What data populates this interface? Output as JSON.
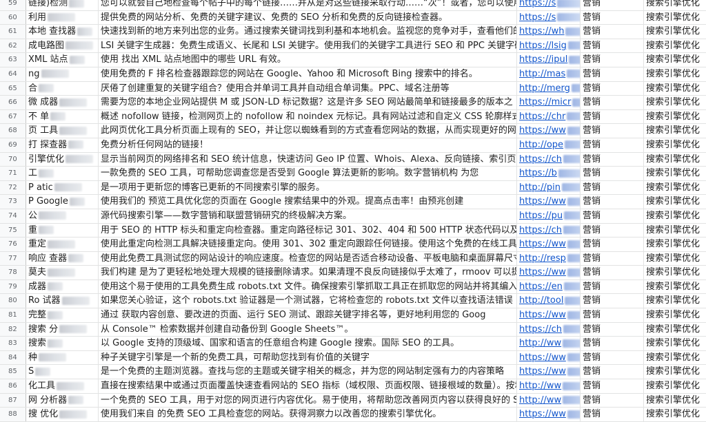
{
  "rows": [
    {
      "n": "59",
      "name": "链接)检测",
      "desc": "您可以就会自己地检查每个帖子中的每个链接……并从是对这些链接采取行动……“次”！或者，您可以使用",
      "url": "https://s",
      "cat": "营销",
      "sub": "搜索引擎优化"
    },
    {
      "n": "60",
      "name": "利用",
      "desc": "提供免费的网站分析、免费的关键字建议、免费的 SEO 分析和免费的反向链接检查器。",
      "url": "https://s",
      "cat": "营销",
      "sub": "搜索引擎优化"
    },
    {
      "n": "61",
      "name": "本地 查找器",
      "desc": "快速找到新的地方来列出您的业务。通过搜索关键词找到利基和本地机会。监视您的竞争对手，查看他们的引用并",
      "url": "https://wh",
      "cat": "营销",
      "sub": "搜索引擎优化"
    },
    {
      "n": "62",
      "name": "成电路图",
      "desc": "LSI 关键字生成器：免费生成语义、长尾和 LSI 关键字。使用我们的关键字工具进行 SEO 和 PPC 关键字研究、页",
      "url": "https://lsig",
      "cat": "营销",
      "sub": "搜索引擎优化"
    },
    {
      "n": "63",
      "name": "XML 站点",
      "desc": "使用 找出 XML 站点地图中的哪些 URL 有效。",
      "url": "https://ipul",
      "cat": "营销",
      "sub": "搜索引擎优化"
    },
    {
      "n": "64",
      "name": "ng",
      "desc": "使用免费的 F 排名检查器跟踪您的网站在 Google、Yahoo 和 Microsoft Bing 搜索中的排名。",
      "url": "http://mas",
      "cat": "营销",
      "sub": "搜索引擎优化"
    },
    {
      "n": "65",
      "name": "合",
      "desc": "厌倦了创建重复的关键字组合？使用合并单词工具并自动组合单词集。PPC、域名注册等",
      "url": "http://merg",
      "cat": "营销",
      "sub": "搜索引擎优化"
    },
    {
      "n": "66",
      "name": "微 成器",
      "desc": "需要为您的本地企业网站提供 M 或 JSON-LD 标记数据？这是许多 SEO 网站最简单和链接最多的版本之",
      "url": "https://micr",
      "cat": "营销",
      "sub": "搜索引擎优化"
    },
    {
      "n": "67",
      "name": "不 单",
      "desc": "概述 nofollow 链接，检测网页上的 nofollow 和 noindex 元标记。具有网站过滤和自定义 CSS 轮廓样式。",
      "url": "https://chr",
      "cat": "营销",
      "sub": "搜索引擎优化"
    },
    {
      "n": "68",
      "name": "页 工具",
      "desc": "此网页优化工具分析页面上现有的 SEO，并让您以蜘蛛看到的方式查看您网站的数据，从而实现更好的网页优化。",
      "url": "https://ww",
      "cat": "营销",
      "sub": "搜索引擎优化"
    },
    {
      "n": "69",
      "name": "打 探查器",
      "desc": "免费分析任何网站的链接！",
      "url": "http://ope",
      "cat": "营销",
      "sub": "搜索引擎优化"
    },
    {
      "n": "70",
      "name": "引擎优化",
      "desc": "显示当前网页的网络排名和 SEO 统计信息，快速访问 Geo IP 位置、Whois、Alexa、反向链接、索引页面等。",
      "url": "https://ch",
      "cat": "营销",
      "sub": "搜索引擎优化"
    },
    {
      "n": "71",
      "name": "工",
      "desc": "一款免费的 SEO 工具，可帮助您调查您是否受到 Google 算法更新的影响。数字营销机构 为您",
      "url": "https://b",
      "cat": "营销",
      "sub": "搜索引擎优化"
    },
    {
      "n": "72",
      "name": "P atic",
      "desc": "是一项用于更新您的博客已更新的不同搜索引擎的服务。",
      "url": "http://pin",
      "cat": "营销",
      "sub": "搜索引擎优化"
    },
    {
      "n": "73",
      "name": "P Google",
      "desc": "使用我们的 预览工具优化您的页面在 Google 搜索结果中的外观。提高点击率！由预兆创建",
      "url": "https://ww",
      "cat": "营销",
      "sub": "搜索引擎优化"
    },
    {
      "n": "74",
      "name": "公",
      "desc": "源代码搜索引擎——数字营销和联盟营销研究的终极解决方案。",
      "url": "https://pu",
      "cat": "营销",
      "sub": "搜索引擎优化"
    },
    {
      "n": "75",
      "name": "重",
      "desc": "用于 SEO 的 HTTP 标头和重定向检查器。重定向路径标记 301、302、404 和 500 HTTP 状态代码以及客户端重",
      "url": "https://ch",
      "cat": "营销",
      "sub": "搜索引擎优化"
    },
    {
      "n": "76",
      "name": "重定",
      "desc": "使用此重定向检测工具解决链接重定向。使用 301、302 重定向跟踪任何链接。使用这个免费的在线工具测试 UR",
      "url": "https://ww",
      "cat": "营销",
      "sub": "搜索引擎优化"
    },
    {
      "n": "77",
      "name": "响应 查器",
      "desc": "使用此免费工具测试您的网站设计的响应速度。检查您的网站是否适合移动设备、平板电脑和桌面屏幕尺寸",
      "url": "http://resp",
      "cat": "营销",
      "sub": "搜索引擎优化"
    },
    {
      "n": "78",
      "name": "莫夫",
      "desc": "我们构建 是为了更轻松地处理大规模的链接删除请求。如果清理不良反向链接似乎太难了，rmoov 可以提供",
      "url": "https://ww",
      "cat": "营销",
      "sub": "搜索引擎优化"
    },
    {
      "n": "79",
      "name": "成器",
      "desc": "使用这个易于使用的工具免费生成 robots.txt 文件。确保搜索引擎抓取工具正在抓取您的网站并将其编入索引。",
      "url": "https://en",
      "cat": "营销",
      "sub": "搜索引擎优化"
    },
    {
      "n": "80",
      "name": "Ro 试器",
      "desc": "如果您关心验证，这个 robots.txt 验证器是一个测试器，它将检查您的 robots.txt 文件以查找语法错误",
      "url": "http://tool",
      "cat": "营销",
      "sub": "搜索引擎优化"
    },
    {
      "n": "81",
      "name": "完整",
      "desc": "通过 获取内容创意、要改进的页面、运行 SEO 测试、跟踪关键字排名等，更好地利用您的 Goog",
      "url": "https://ww",
      "cat": "营销",
      "sub": "搜索引擎优化"
    },
    {
      "n": "82",
      "name": "搜索 分",
      "desc": "从 Console™ 检索数据并创建自动备份到 Google Sheets™。",
      "url": "https://ch",
      "cat": "营销",
      "sub": "搜索引擎优化"
    },
    {
      "n": "83",
      "name": "搜索",
      "desc": "以 Google 支持的顶级域、国家和语言的任意组合构建 Google 搜索。国际 SEO 的工具。",
      "url": "http://ww",
      "cat": "营销",
      "sub": "搜索引擎优化"
    },
    {
      "n": "84",
      "name": "种",
      "desc": "种子关键字引擎是一个新的免费工具，可帮助您找到有价值的关键字",
      "url": "https://ww",
      "cat": "营销",
      "sub": "搜索引擎优化"
    },
    {
      "n": "85",
      "name": "S",
      "desc": "是一个免费的主题浏览器。查找与您的主题或关键字相关的概念，并为您的网站制定强有力的内容策略",
      "url": "https://ww",
      "cat": "营销",
      "sub": "搜索引擎优化"
    },
    {
      "n": "86",
      "name": "化工具",
      "desc": "直接在搜索结果中或通过页面覆盖快速查看网站的 SEO 指标（域权限、页面权限、链接根域的数量）。按地区或",
      "url": "http://ww",
      "cat": "营销",
      "sub": "搜索引擎优化"
    },
    {
      "n": "87",
      "name": "网 分析器",
      "desc": "一个免费的 SEO 工具，用于对您的网页进行内容优化。易于使用，将帮助您改善网页内容以获得良好的 SEO。",
      "url": "http://ww",
      "cat": "营销",
      "sub": "搜索引擎优化"
    },
    {
      "n": "88",
      "name": "搜 优化",
      "desc": "使用我们来自 的免费 SEO 工具检查您的网站。获得洞察力以改善您的搜索引擎优化。",
      "url": "https://ww",
      "cat": "营销",
      "sub": "搜索引擎优化"
    }
  ]
}
